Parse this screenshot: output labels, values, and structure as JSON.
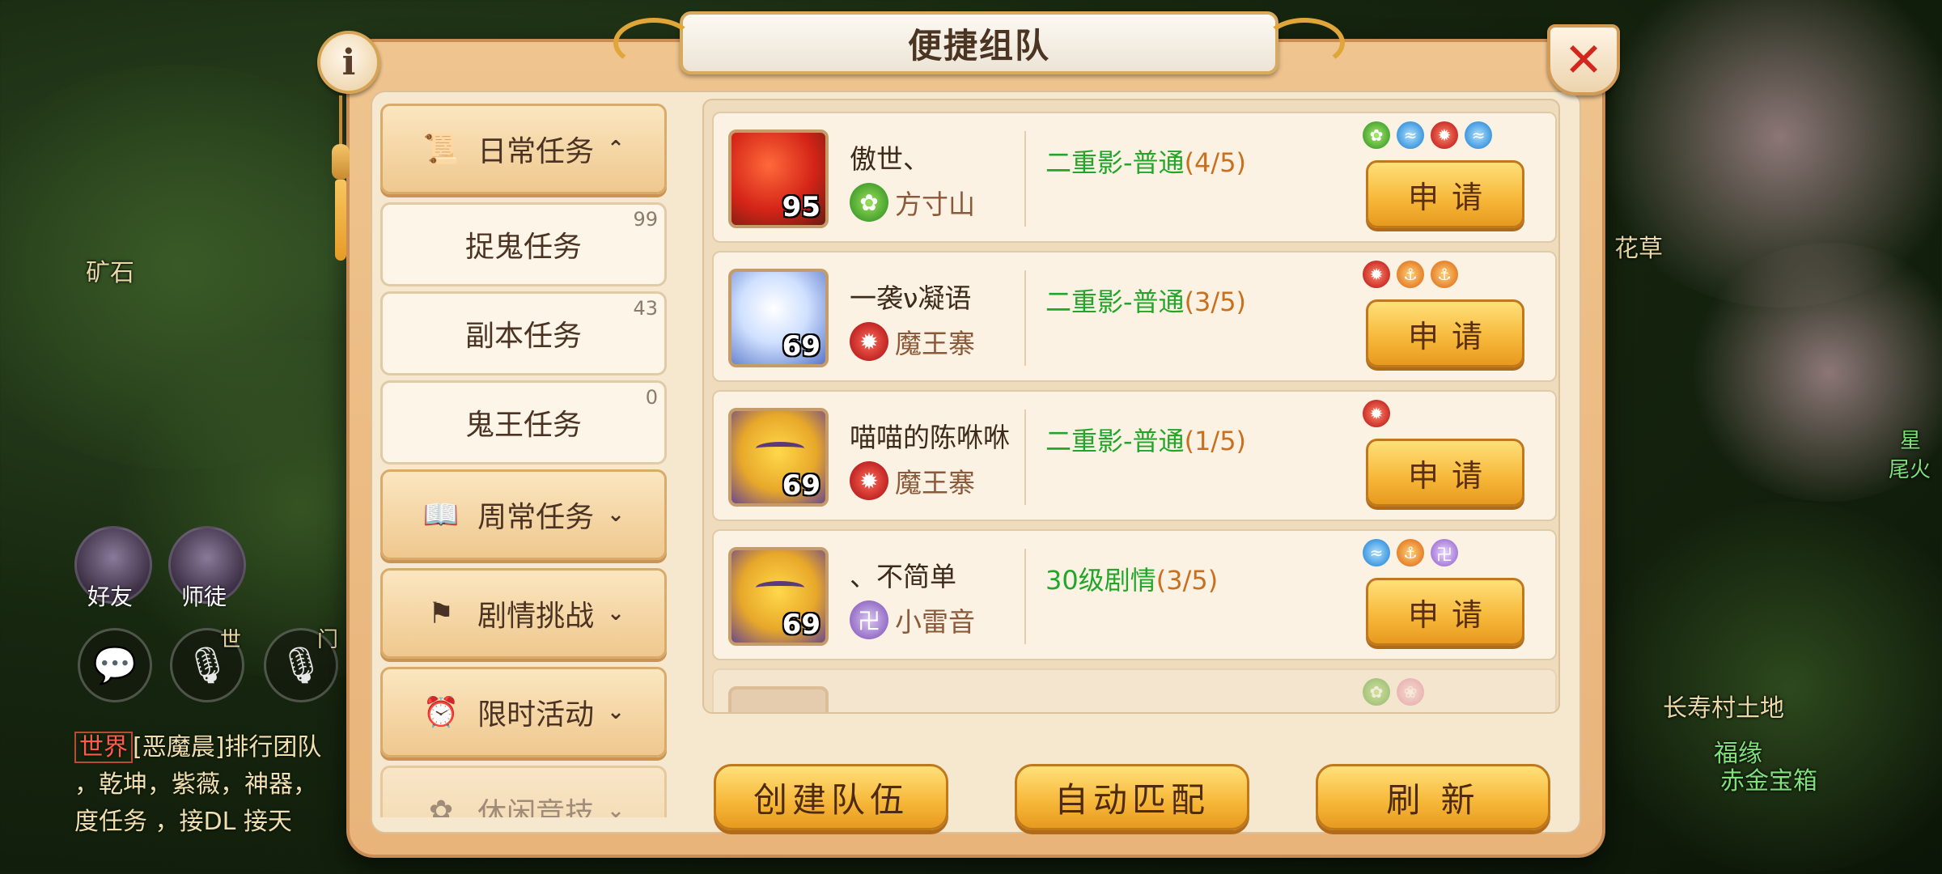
{
  "panel": {
    "title": "便捷组队",
    "info_label": "i"
  },
  "sidebar": {
    "items": [
      {
        "type": "category",
        "label": "日常任务",
        "icon": "scroll-icon",
        "icon_glyph": "📜",
        "chevron": "⌃",
        "expanded": true
      },
      {
        "type": "sub",
        "label": "捉鬼任务",
        "count": "99"
      },
      {
        "type": "sub",
        "label": "副本任务",
        "count": "43"
      },
      {
        "type": "sub",
        "label": "鬼王任务",
        "count": "0"
      },
      {
        "type": "category",
        "label": "周常任务",
        "icon": "book-icon",
        "icon_glyph": "📖",
        "chevron": "⌄",
        "expanded": false
      },
      {
        "type": "category",
        "label": "剧情挑战",
        "icon": "flag-icon",
        "icon_glyph": "⚑",
        "chevron": "⌄",
        "expanded": false
      },
      {
        "type": "category",
        "label": "限时活动",
        "icon": "alarm-clock-icon",
        "icon_glyph": "⏰",
        "chevron": "⌄",
        "expanded": false
      },
      {
        "type": "category",
        "label": "休闲竞技",
        "icon": "butterfly-icon",
        "icon_glyph": "✿",
        "chevron": "⌄",
        "expanded": false
      }
    ]
  },
  "teams": [
    {
      "name": "傲世、",
      "level": "95",
      "avatar": "red-hair-hero",
      "sect": "方寸山",
      "sect_icon": "fangcun-sect-icon",
      "activity": "二重影-普通",
      "count": "(4/5)",
      "class_icons": [
        "green",
        "blue",
        "red",
        "blue"
      ],
      "apply_label": "申请"
    },
    {
      "name": "一袭ν凝语",
      "level": "69",
      "avatar": "white-hair-hero",
      "sect": "魔王寨",
      "sect_icon": "mowang-sect-icon",
      "activity": "二重影-普通",
      "count": "(3/5)",
      "class_icons": [
        "red",
        "orange",
        "orange"
      ],
      "apply_label": "申请"
    },
    {
      "name": "喵喵的陈咻咻",
      "level": "69",
      "avatar": "tiger-hero",
      "sect": "魔王寨",
      "sect_icon": "mowang-sect-icon",
      "activity": "二重影-普通",
      "count": "(1/5)",
      "class_icons": [
        "red"
      ],
      "apply_label": "申请"
    },
    {
      "name": "、不简单",
      "level": "69",
      "avatar": "tiger-hero",
      "sect": "小雷音",
      "sect_icon": "leiyin-sect-icon",
      "activity": "30级剧情",
      "count": "(3/5)",
      "class_icons": [
        "blue",
        "orange",
        "purple"
      ],
      "apply_label": "申请"
    },
    {
      "name": "",
      "level": "",
      "avatar": "partial",
      "sect": "",
      "sect_icon": "",
      "activity": "",
      "count": "",
      "class_icons": [
        "green",
        "pink"
      ],
      "apply_label": ""
    }
  ],
  "bottom": {
    "create_label": "创建队伍",
    "match_label": "自动匹配",
    "refresh_label": "刷 新"
  },
  "background": {
    "labels": [
      "矿石",
      "好友",
      "师徒",
      "世",
      "门",
      "长寿村土地",
      "福缘",
      "赤金宝箱",
      "花草",
      "星",
      "尾火"
    ],
    "chat": {
      "tag": "世界",
      "line1": "[恶魔晨]排行团队",
      "line2": "，乾坤，紫薇，神器，",
      "line3": "度任务 ，接DL 接天"
    },
    "chat_icon": "chat-bubble-icon",
    "mic_icon": "microphone-icon"
  },
  "colors": {
    "accent_gold": "#f6b637",
    "activity_green": "#22a62a",
    "count_orange": "#c8701e",
    "close_red": "#d3261d",
    "panel_bg": "#f6e7cf"
  }
}
